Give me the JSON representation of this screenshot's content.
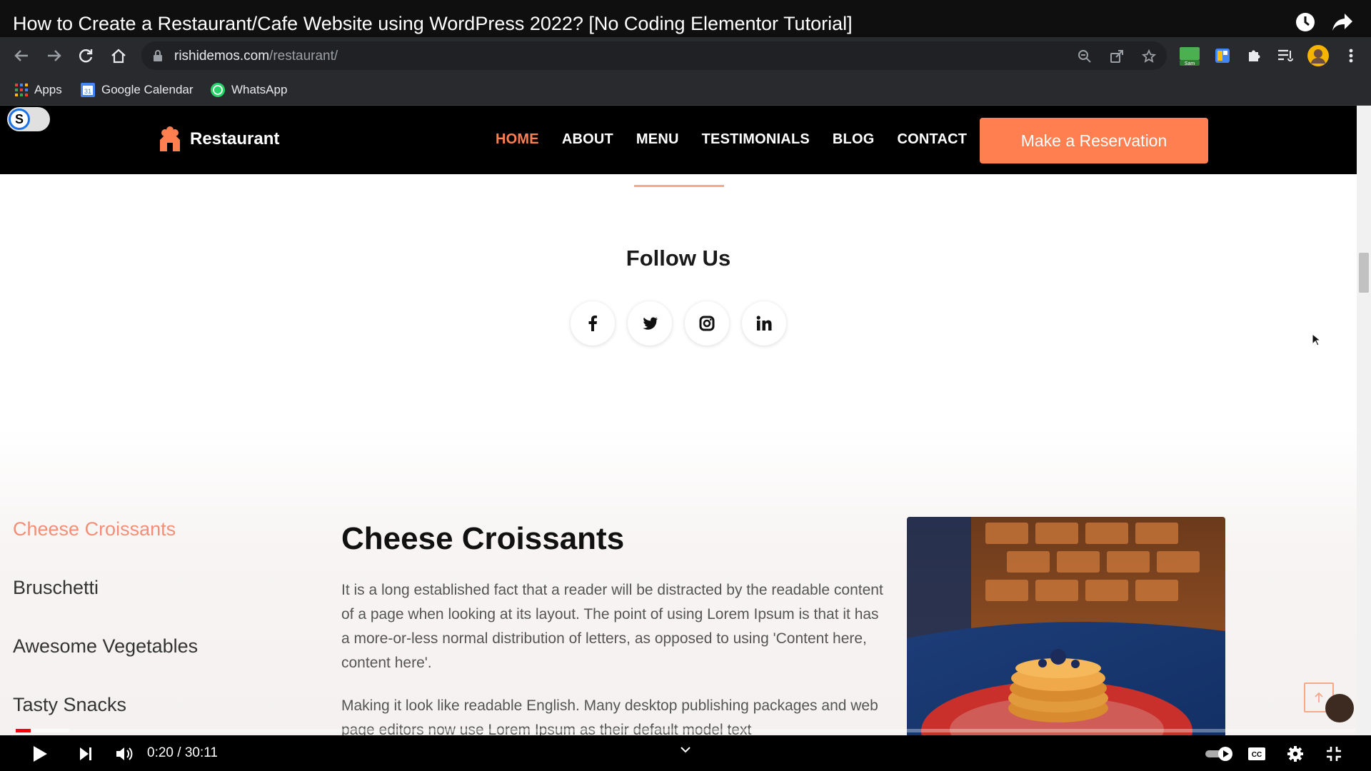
{
  "video": {
    "title": "How to Create a Restaurant/Cafe Website using WordPress 2022? [No Coding Elementor Tutorial]",
    "time": "0:20 / 30:11",
    "progress_played": 0.011,
    "progress_buffered": 0.04
  },
  "browser": {
    "url_domain": "rishidemos.com",
    "url_path": "/restaurant/",
    "bookmarks": [
      "Apps",
      "Google Calendar",
      "WhatsApp"
    ],
    "profile_ext_label": "Sam"
  },
  "site": {
    "logo_text": "Restaurant",
    "nav": [
      "HOME",
      "ABOUT",
      "MENU",
      "TESTIMONIALS",
      "BLOG",
      "CONTACT"
    ],
    "reserve_label": "Make a Reservation",
    "follow_title": "Follow Us",
    "social": [
      "f",
      "twitter",
      "instagram",
      "in"
    ],
    "menu_tabs": [
      "Cheese Croissants",
      "Bruschetti",
      "Awesome Vegetables",
      "Tasty Snacks"
    ],
    "dish": {
      "title": "Cheese Croissants",
      "paragraph1": "It is a long established fact that a reader will be distracted by the readable content of a page when looking at its layout. The point of using Lorem Ipsum is that it has a more-or-less normal distribution of letters, as opposed to using 'Content here, content here'.",
      "paragraph2": "Making it look like readable English. Many desktop publishing packages and web page editors now use Lorem Ipsum as their default model text"
    },
    "toggle_label": "S"
  },
  "colors": {
    "accent": "#ff7f50",
    "accent_soft": "#f28f76",
    "header_bg": "#000000"
  }
}
